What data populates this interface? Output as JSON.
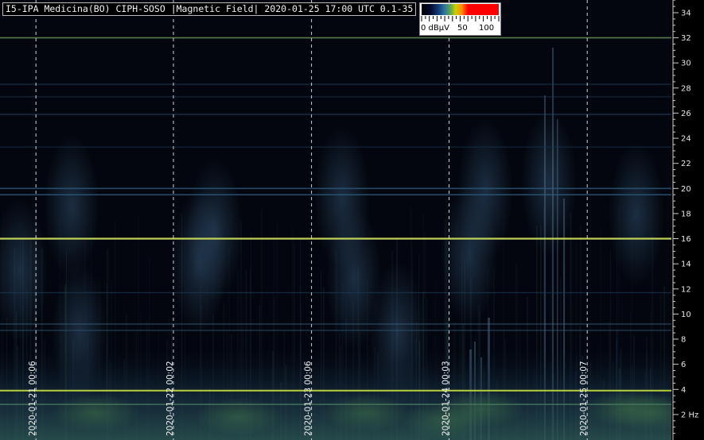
{
  "header": {
    "title": "I5-IPA Medicina(BO) CIPH-SOSO |Magnetic Field| 2020-01-25 17:00 UTC 0.1-35"
  },
  "color_scale": {
    "labels": [
      "0 dBµV",
      "50",
      "100"
    ],
    "values": [
      0,
      50,
      100
    ]
  },
  "chart_data": {
    "type": "heatmap",
    "title": "I5-IPA Medicina(BO) CIPH-SOSO |Magnetic Field| 2020-01-25 17:00 UTC 0.1-35",
    "ylabel": "",
    "xlabel": "",
    "y_unit": "Hz",
    "ylim": [
      0.1,
      35
    ],
    "y_ticks": [
      2,
      4,
      6,
      8,
      10,
      12,
      14,
      16,
      18,
      20,
      22,
      24,
      26,
      28,
      30,
      32,
      34
    ],
    "y_tick_labels": [
      "2 Hz",
      "4",
      "6",
      "8",
      "10",
      "12",
      "14",
      "16",
      "18",
      "20",
      "22",
      "24",
      "26",
      "28",
      "30",
      "32",
      "34"
    ],
    "x_range": [
      "2020-01-20 17:00",
      "2020-01-25 17:00"
    ],
    "x_markers": [
      {
        "label": "2020-01-21 00:06",
        "value": "2020-01-21 00:06"
      },
      {
        "label": "2020-01-22 00:02",
        "value": "2020-01-22 00:02"
      },
      {
        "label": "2020-01-23 00:06",
        "value": "2020-01-23 00:06"
      },
      {
        "label": "2020-01-24 00:03",
        "value": "2020-01-24 00:03"
      },
      {
        "label": "2020-01-25 00:07",
        "value": "2020-01-25 00:07"
      }
    ],
    "grid": "vertical dashed at x markers",
    "colorbar": {
      "label": "dBµV",
      "range": [
        0,
        100
      ]
    },
    "persistent_lines_hz": [
      {
        "hz": 3.9,
        "strength": "strong",
        "color": "#b8cf3c"
      },
      {
        "hz": 16.0,
        "strength": "strong",
        "color": "#c9dc5a"
      },
      {
        "hz": 32.0,
        "strength": "medium",
        "color": "#6d9a58"
      },
      {
        "hz": 19.5,
        "strength": "medium",
        "color": "#2c5a7c"
      },
      {
        "hz": 20.0,
        "strength": "medium",
        "color": "#2c5a7c"
      },
      {
        "hz": 25.9,
        "strength": "weak",
        "color": "#244c6c"
      },
      {
        "hz": 28.3,
        "strength": "weak",
        "color": "#1f4260"
      },
      {
        "hz": 27.3,
        "strength": "weak",
        "color": "#1b3a55"
      },
      {
        "hz": 23.3,
        "strength": "weak",
        "color": "#183450"
      },
      {
        "hz": 11.7,
        "strength": "weak",
        "color": "#1d3d5a"
      },
      {
        "hz": 9.2,
        "strength": "weak",
        "color": "#3a6680"
      },
      {
        "hz": 8.7,
        "strength": "weak",
        "color": "#325a75"
      },
      {
        "hz": 2.8,
        "strength": "medium",
        "color": "#4a7a60"
      }
    ]
  }
}
